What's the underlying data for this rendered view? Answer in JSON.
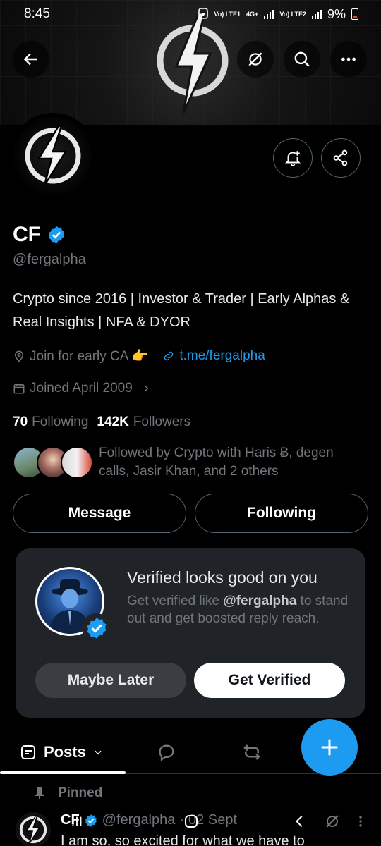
{
  "status_bar": {
    "time": "8:45",
    "net1": "Vo) LTE1",
    "net_type": "4G+",
    "net2": "Vo) LTE2",
    "battery": "9%"
  },
  "profile": {
    "name": "CF",
    "handle": "@fergalpha",
    "bio": "Crypto since 2016 | Investor & Trader | Early Alphas & Real Insights | NFA & DYOR",
    "location": "Join for early CA 👉",
    "link": "t.me/fergalpha",
    "joined": "Joined April 2009",
    "following_count": "70",
    "following_label": "Following",
    "followers_count": "142K",
    "followers_label": "Followers",
    "followed_by": "Followed by Crypto with Haris Ƀ, degen calls, Jasir Khan, and 2 others"
  },
  "buttons": {
    "message": "Message",
    "following": "Following"
  },
  "verified_card": {
    "title": "Verified looks good on you",
    "text_prefix": "Get verified like ",
    "text_handle": "@fergalpha",
    "text_suffix": " to stand out and get boosted reply reach.",
    "maybe_later": "Maybe Later",
    "get_verified": "Get Verified"
  },
  "tabs": {
    "posts": "Posts"
  },
  "pinned_post": {
    "pinned_label": "Pinned",
    "author": "CF",
    "handle": "@fergalpha",
    "date": "02 Sept",
    "text": "I am so, so excited for what we have to"
  },
  "colors": {
    "accent": "#1d9bf0",
    "background": "#000000",
    "card": "#202327",
    "muted": "#71767b"
  }
}
